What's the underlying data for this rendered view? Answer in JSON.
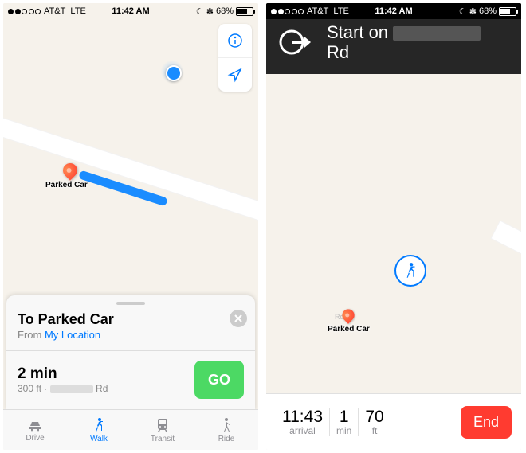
{
  "status": {
    "carrier": "AT&T",
    "network": "LTE",
    "time": "11:42 AM",
    "battery": "68%",
    "moon": "☾",
    "bt": "✽"
  },
  "left": {
    "card_title": "To Parked Car",
    "from_label": "From",
    "from_value": "My Location",
    "eta": "2 min",
    "distance": "300 ft · ",
    "road_suffix": "Rd",
    "go": "GO",
    "pin_label": "Parked Car",
    "tabs": [
      "Drive",
      "Walk",
      "Transit",
      "Ride"
    ]
  },
  "right": {
    "banner_prefix": "Start on ",
    "banner_suffix": "Rd",
    "pin_label": "Parked Car",
    "rd": "Rd",
    "arrival_val": "11:43",
    "arrival_lbl": "arrival",
    "min_val": "1",
    "min_lbl": "min",
    "ft_val": "70",
    "ft_lbl": "ft",
    "end": "End"
  }
}
